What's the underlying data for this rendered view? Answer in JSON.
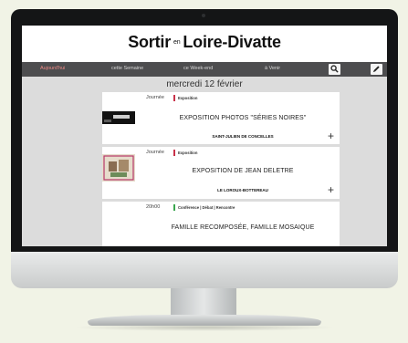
{
  "site": {
    "title_part1": "Sortir",
    "title_connector": "en",
    "title_part2": "Loire-Divatte"
  },
  "nav": {
    "items": [
      {
        "label": "Aujourd'hui",
        "active": true
      },
      {
        "label": "cette Semaine",
        "active": false
      },
      {
        "label": "ce Week-end",
        "active": false
      },
      {
        "label": "à Venir",
        "active": false
      }
    ],
    "search_icon": "search-icon",
    "edit_icon": "pencil-icon"
  },
  "date_heading": "mercredi 12 février",
  "events": [
    {
      "time": "Journée",
      "category": "Exposition",
      "category_color": "#c9324a",
      "title": "EXPOSITION PHOTOS \"SÉRIES NOIRES\"",
      "place": "SAINT-JULIEN DE CONCELLES",
      "action": "+"
    },
    {
      "time": "Journée",
      "category": "Exposition",
      "category_color": "#c9324a",
      "title": "EXPOSITION DE JEAN DELETRE",
      "place": "LE LOROUX-BOTTEREAU",
      "action": "+"
    },
    {
      "time": "20h00",
      "category": "Conférence | Débat | Rencontre",
      "category_color": "#3aa64e",
      "title": "FAMILLE RECOMPOSÉE, FAMILLE MOSAIQUE"
    }
  ]
}
